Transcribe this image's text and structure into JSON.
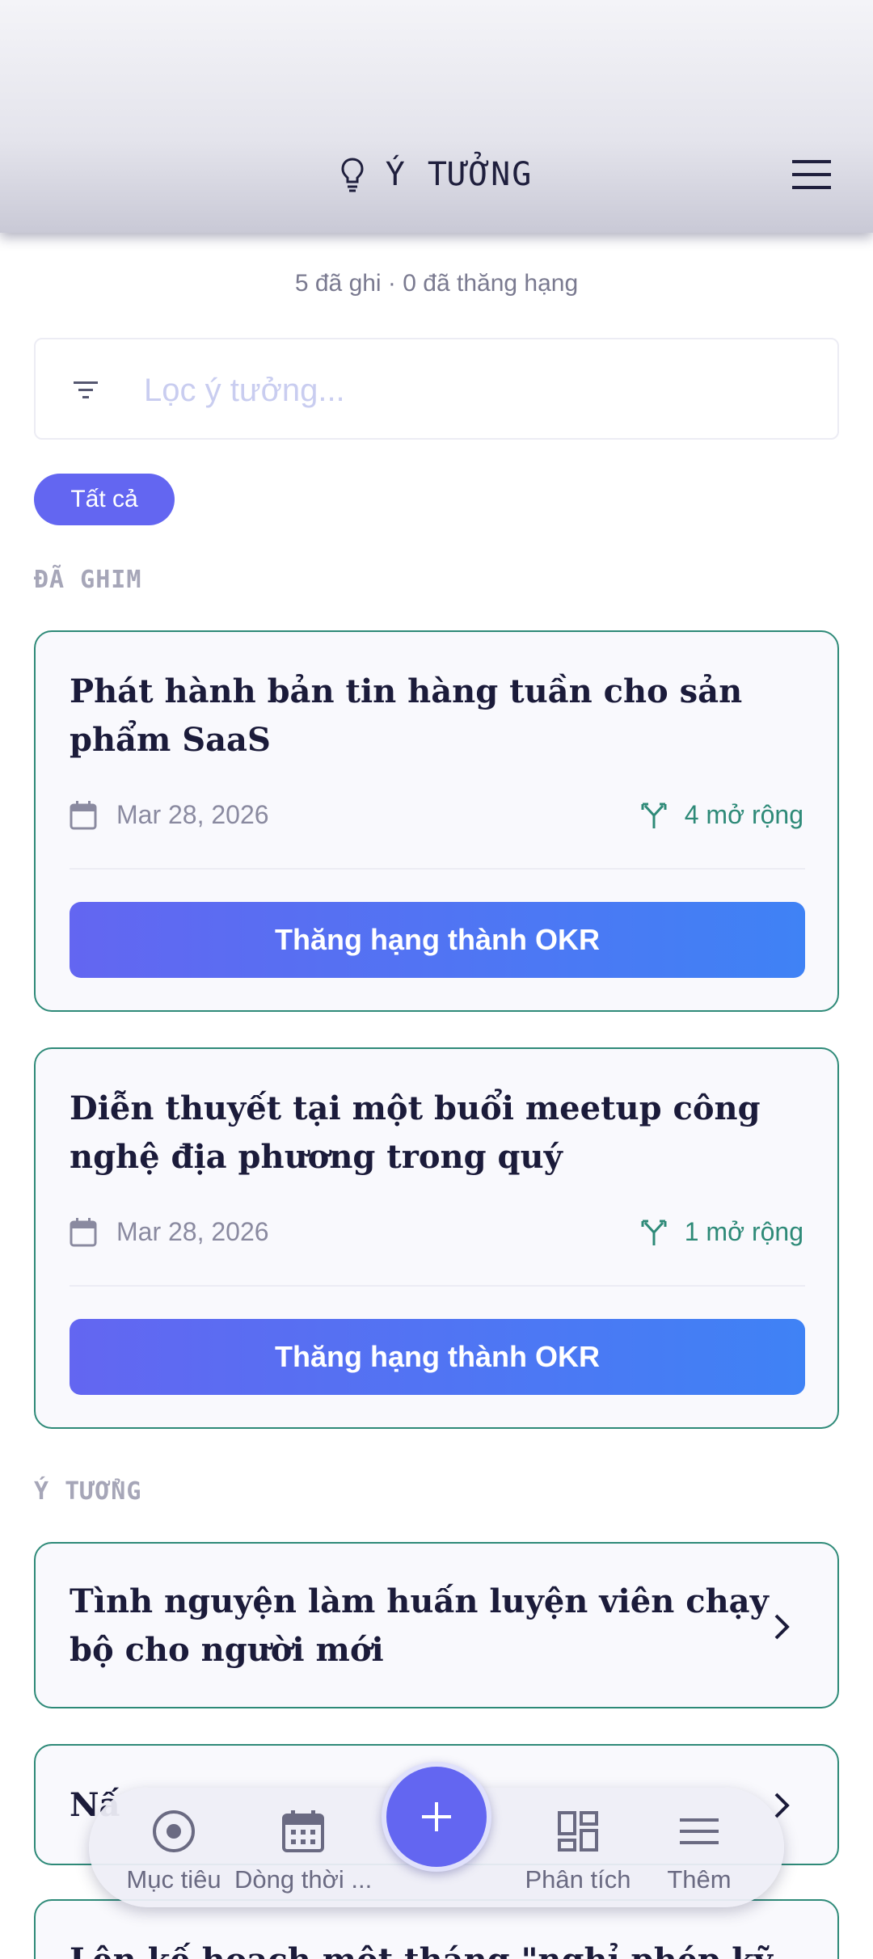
{
  "header": {
    "title": "Ý TƯỞNG"
  },
  "summary": {
    "text": "5 đã ghi · 0 đã thăng hạng"
  },
  "filter": {
    "placeholder": "Lọc ý tưởng..."
  },
  "chips": [
    {
      "label": "Tất cả",
      "selected": true
    }
  ],
  "sections": {
    "pinned": "ĐÃ GHIM",
    "ideas": "Ý TƯỞNG"
  },
  "pinned_cards": [
    {
      "title": "Phát hành bản tin hàng tuần cho sản phẩm SaaS",
      "date": "Mar 28, 2026",
      "expansions": "4 mở rộng",
      "action": "Thăng hạng thành OKR"
    },
    {
      "title": "Diễn thuyết tại một buổi meetup công nghệ địa phương trong quý",
      "date": "Mar 28, 2026",
      "expansions": "1 mở rộng",
      "action": "Thăng hạng thành OKR"
    }
  ],
  "ideas": [
    {
      "title": "Tình nguyện làm huấn luyện viên chạy bộ cho người mới"
    },
    {
      "title": "Nấ"
    },
    {
      "title": "Lên kế hoạch một tháng \"nghỉ phép kỹ"
    }
  ],
  "nav": {
    "items": [
      {
        "label": "Mục tiêu",
        "icon": "target-icon"
      },
      {
        "label": "Dòng thời ...",
        "icon": "calendar-icon"
      },
      {
        "label": "Phân tích",
        "icon": "dashboard-icon"
      },
      {
        "label": "Thêm",
        "icon": "menu-icon"
      }
    ],
    "fab_icon": "plus-icon"
  },
  "colors": {
    "accent": "#6366f1",
    "accent_end": "#3f82f5",
    "teal": "#2e8a78",
    "text": "#1b1b3a"
  }
}
